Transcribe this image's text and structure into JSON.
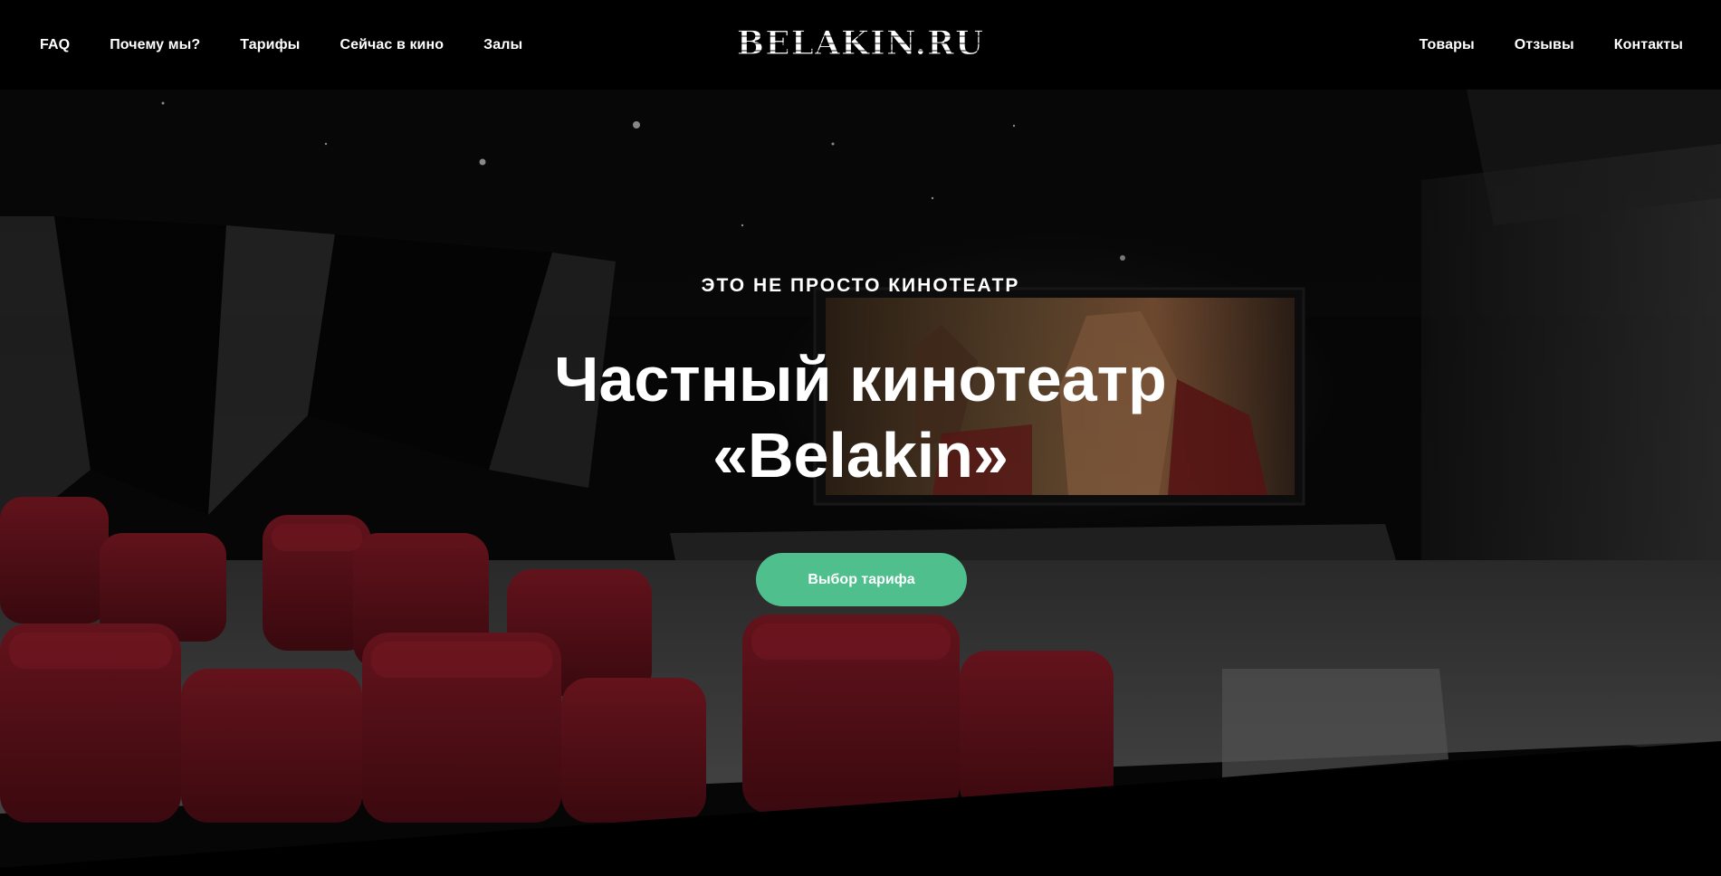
{
  "header": {
    "nav_left": [
      "FAQ",
      "Почему мы?",
      "Тарифы",
      "Сейчас в кино",
      "Залы"
    ],
    "logo_text": "BELAKIN.RU",
    "nav_right": [
      "Товары",
      "Отзывы",
      "Контакты"
    ]
  },
  "hero": {
    "eyebrow": "ЭТО НЕ ПРОСТО КИНОТЕАТР",
    "title_line1": "Частный кинотеатр",
    "title_line2": "«Belakin»",
    "cta_label": "Выбор тарифа"
  },
  "colors": {
    "accent": "#4fc08d",
    "seat_red": "#7a1420",
    "background": "#000000"
  }
}
